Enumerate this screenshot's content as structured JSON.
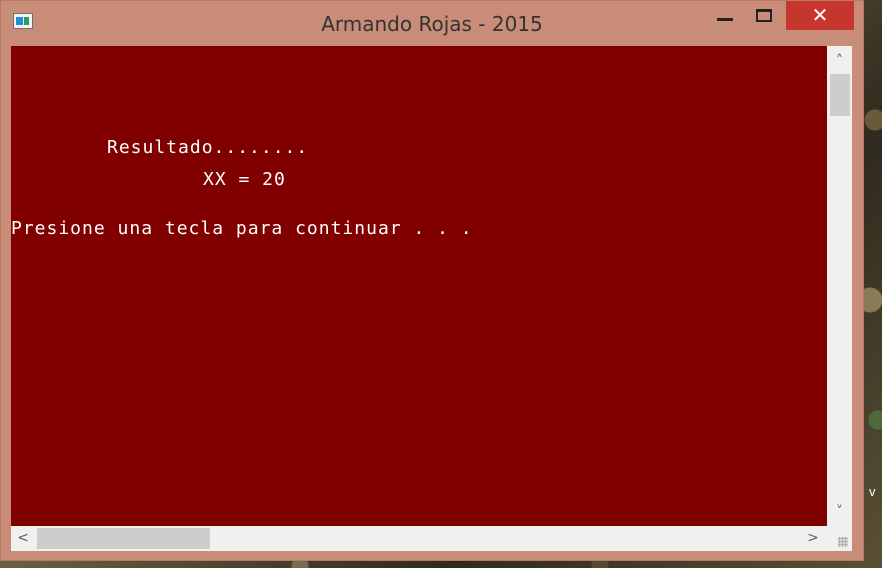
{
  "window": {
    "title": "Armando Rojas - 2015",
    "controls": {
      "close_glyph": "✕"
    }
  },
  "console": {
    "background_color": "#800000",
    "text_color": "#ffffff",
    "lines": [
      "Resultado........",
      "XX = 20",
      "Presione una tecla para continuar . . ."
    ]
  },
  "scrollbars": {
    "up_arrow": "˄",
    "down_arrow": "˅",
    "left_arrow": "<",
    "right_arrow": ">"
  },
  "desktop": {
    "partial_text": "v"
  }
}
